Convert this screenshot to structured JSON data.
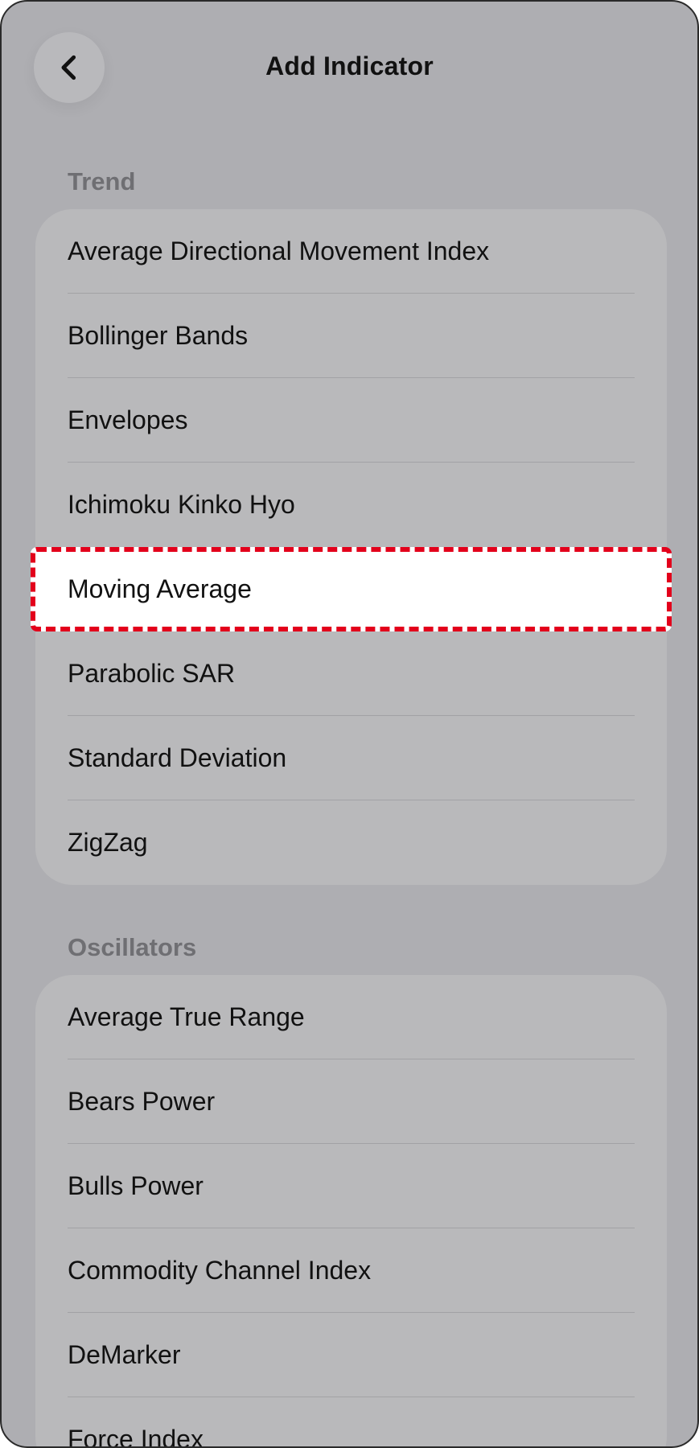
{
  "header": {
    "title": "Add Indicator",
    "back_icon": "chevron-left-icon"
  },
  "sections": {
    "trend": {
      "label": "Trend",
      "items": [
        {
          "label": "Average Directional Movement Index"
        },
        {
          "label": "Bollinger Bands"
        },
        {
          "label": "Envelopes"
        },
        {
          "label": "Ichimoku Kinko Hyo"
        },
        {
          "label": "Moving Average",
          "highlighted": true
        },
        {
          "label": "Parabolic SAR"
        },
        {
          "label": "Standard Deviation"
        },
        {
          "label": "ZigZag"
        }
      ]
    },
    "oscillators": {
      "label": "Oscillators",
      "items": [
        {
          "label": "Average True Range"
        },
        {
          "label": "Bears Power"
        },
        {
          "label": "Bulls Power"
        },
        {
          "label": "Commodity Channel Index"
        },
        {
          "label": "DeMarker"
        },
        {
          "label": "Force Index"
        }
      ]
    }
  },
  "colors": {
    "background": "#aeaeb2",
    "group_background": "#b9b9bb",
    "highlight_border": "#e3001b",
    "highlight_fill": "#ffffff"
  }
}
